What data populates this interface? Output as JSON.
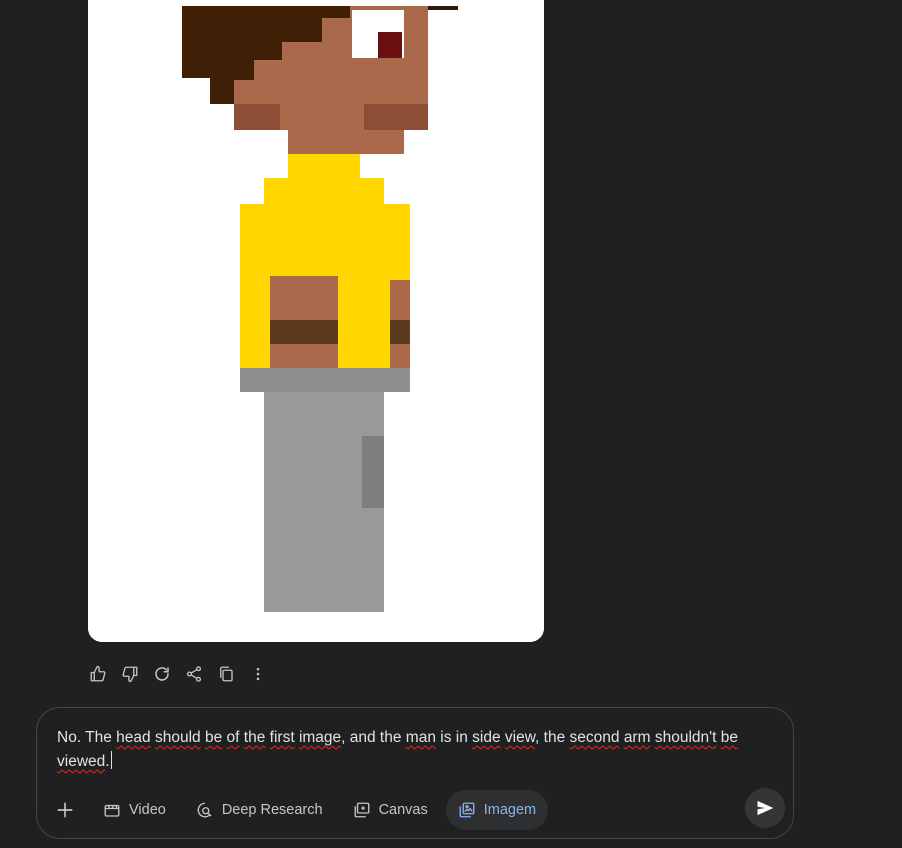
{
  "response_image": {
    "alt": "pixel art man"
  },
  "response_actions": [
    {
      "name": "thumbs-up-icon"
    },
    {
      "name": "thumbs-down-icon"
    },
    {
      "name": "regenerate-icon"
    },
    {
      "name": "share-icon"
    },
    {
      "name": "copy-icon"
    },
    {
      "name": "more-options-icon"
    }
  ],
  "composer": {
    "text_segments": [
      {
        "text": "No. The ",
        "squiggle": false
      },
      {
        "text": "head",
        "squiggle": true
      },
      {
        "text": " ",
        "squiggle": false
      },
      {
        "text": "should",
        "squiggle": true
      },
      {
        "text": " ",
        "squiggle": false
      },
      {
        "text": "be",
        "squiggle": true
      },
      {
        "text": " ",
        "squiggle": false
      },
      {
        "text": "of",
        "squiggle": true
      },
      {
        "text": " ",
        "squiggle": false
      },
      {
        "text": "the",
        "squiggle": true
      },
      {
        "text": " ",
        "squiggle": false
      },
      {
        "text": "first",
        "squiggle": true
      },
      {
        "text": " ",
        "squiggle": false
      },
      {
        "text": "image",
        "squiggle": true
      },
      {
        "text": ", and the ",
        "squiggle": false
      },
      {
        "text": "man",
        "squiggle": true
      },
      {
        "text": " is in ",
        "squiggle": false
      },
      {
        "text": "side",
        "squiggle": true
      },
      {
        "text": " ",
        "squiggle": false
      },
      {
        "text": "view",
        "squiggle": true
      },
      {
        "text": ", the ",
        "squiggle": false
      },
      {
        "text": "second",
        "squiggle": true
      },
      {
        "text": " ",
        "squiggle": false
      },
      {
        "text": "arm",
        "squiggle": true
      },
      {
        "text": " ",
        "squiggle": false
      },
      {
        "text": "shouldn't",
        "squiggle": true
      },
      {
        "text": " ",
        "squiggle": false
      },
      {
        "text": "be",
        "squiggle": true
      },
      {
        "text": " ",
        "squiggle": false
      },
      {
        "text": "viewed",
        "squiggle": true
      },
      {
        "text": ".",
        "squiggle": false
      }
    ],
    "tools": {
      "add": {
        "icon": "plus-icon"
      },
      "video": {
        "label": "Video",
        "icon": "video-icon"
      },
      "deep_research": {
        "label": "Deep Research",
        "icon": "deep-research-icon"
      },
      "canvas": {
        "label": "Canvas",
        "icon": "canvas-icon"
      },
      "image": {
        "label": "Imagem",
        "icon": "image-icon",
        "active": true
      }
    },
    "send": {
      "icon": "send-icon"
    }
  },
  "colors": {
    "background": "#1f2021",
    "active_tool_text": "#8ab4f8",
    "skin": "#a9694a",
    "hair": "#3f1f05",
    "shirt": "#ffd600",
    "pants": "#8e8e8e",
    "belt": "#5c3a1e"
  }
}
